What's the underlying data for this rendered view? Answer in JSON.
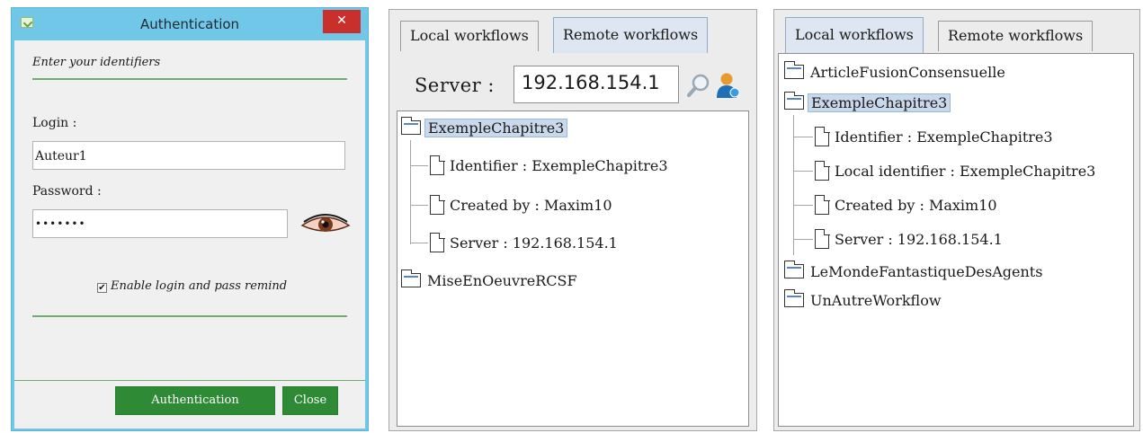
{
  "auth": {
    "title": "Authentication",
    "close_glyph": "✕",
    "subtitle": "Enter your identifiers",
    "login_label": "Login :",
    "login_value": "Auteur1",
    "password_label": "Password :",
    "password_mask": "•••••••",
    "remind_label": "Enable login and pass remind",
    "remind_checked": true,
    "auth_button": "Authentication",
    "close_button": "Close",
    "colors": {
      "titlebar": "#70c7e8",
      "close": "#c9302c",
      "button": "#2f8a35"
    }
  },
  "remote_panel": {
    "tabs": [
      "Local workflows",
      "Remote workflows"
    ],
    "active_tab": "Remote workflows",
    "server_label": "Server :",
    "server_value": "192.168.154.1",
    "tree": {
      "root1": "ExempleChapitre3",
      "children": [
        "Identifier : ExempleChapitre3",
        "Created by : Maxim10",
        "Server : 192.168.154.1"
      ],
      "root2": "MiseEnOeuvreRCSF"
    }
  },
  "local_panel": {
    "tabs": [
      "Local workflows",
      "Remote workflows"
    ],
    "active_tab": "Local workflows",
    "tree": {
      "item1": "ArticleFusionConsensuelle",
      "item2": "ExempleChapitre3",
      "children": [
        "Identifier : ExempleChapitre3",
        "Local identifier : ExempleChapitre3",
        "Created by : Maxim10",
        "Server : 192.168.154.1"
      ],
      "item3": "LeMondeFantastiqueDesAgents",
      "item4": "UnAutreWorkflow"
    }
  },
  "icons": [
    "app-icon",
    "close-icon",
    "eye-icon",
    "checkbox-icon",
    "folder-icon",
    "file-icon",
    "search-icon",
    "user-icon"
  ]
}
